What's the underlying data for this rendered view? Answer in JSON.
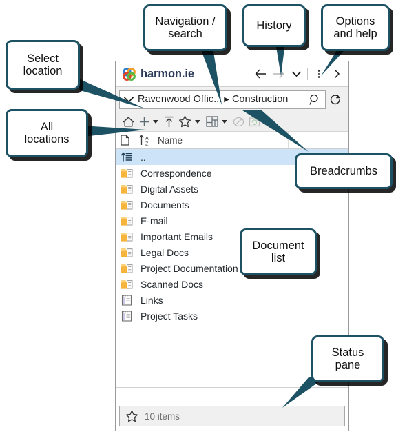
{
  "app": {
    "name": "harmon.ie",
    "brand_color": "#2b3b57",
    "logo_icon": "harmonie-rings-logo",
    "logo_colors": [
      "#2f7fd1",
      "#58b947",
      "#f0a02a",
      "#e0452c"
    ]
  },
  "titlebar": {
    "buttons": [
      {
        "name": "back-button",
        "icon": "arrow-left-icon",
        "label": "←",
        "state": "enabled"
      },
      {
        "name": "forward-button",
        "icon": "arrow-right-icon",
        "label": "→",
        "state": "disabled"
      },
      {
        "name": "history-button",
        "icon": "chevron-down-icon",
        "label": "⌄",
        "state": "enabled"
      },
      {
        "name": "options-button",
        "icon": "kebab-menu-icon",
        "label": "⋮",
        "state": "enabled"
      },
      {
        "name": "help-button",
        "icon": "chevron-right-icon",
        "label": "›",
        "state": "enabled"
      }
    ]
  },
  "location_bar": {
    "select_location_icon": "chevron-down-icon",
    "breadcrumbs": [
      "Ravenwood Offic...",
      "Construction"
    ],
    "separator": "▶",
    "search_icon": "magnifier-icon",
    "refresh_icon": "refresh-icon"
  },
  "command_bar": {
    "items": [
      {
        "name": "all-locations-button",
        "icon": "home-icon",
        "state": "enabled",
        "caret": false
      },
      {
        "name": "new-item-button",
        "icon": "plus-icon",
        "state": "enabled",
        "caret": true
      },
      {
        "name": "upload-button",
        "icon": "upload-arrow-icon",
        "state": "enabled",
        "caret": false
      },
      {
        "name": "favorites-button",
        "icon": "star-icon",
        "state": "enabled",
        "caret": true
      },
      {
        "name": "view-layout-button",
        "icon": "layout-grid-icon",
        "state": "enabled",
        "caret": true
      },
      {
        "name": "no-preview-button",
        "icon": "slashed-circle-icon",
        "state": "disabled",
        "caret": false
      },
      {
        "name": "sync-button",
        "icon": "sync-folder-icon",
        "state": "disabled",
        "caret": false
      }
    ]
  },
  "list_header": {
    "doc_icon": "document-icon",
    "sort_icon": "sort-az-icon",
    "name_column": "Name"
  },
  "document_list": {
    "rows": [
      {
        "icon": "up-level-icon",
        "label": "..",
        "selected": true
      },
      {
        "icon": "folder-icon",
        "label": "Correspondence",
        "selected": false
      },
      {
        "icon": "folder-icon",
        "label": "Digital Assets",
        "selected": false
      },
      {
        "icon": "folder-icon",
        "label": "Documents",
        "selected": false
      },
      {
        "icon": "folder-icon",
        "label": "E-mail",
        "selected": false
      },
      {
        "icon": "folder-icon",
        "label": "Important Emails",
        "selected": false
      },
      {
        "icon": "folder-icon",
        "label": "Legal Docs",
        "selected": false
      },
      {
        "icon": "folder-icon",
        "label": "Project Documentation",
        "selected": false
      },
      {
        "icon": "folder-icon",
        "label": "Scanned Docs",
        "selected": false
      },
      {
        "icon": "list-icon",
        "label": "Links",
        "selected": false
      },
      {
        "icon": "list-icon",
        "label": "Project Tasks",
        "selected": false
      }
    ]
  },
  "status_pane": {
    "icon": "star-icon",
    "text": "10 items"
  },
  "annotations": {
    "select_location": "Select\nlocation",
    "all_locations": "All\nlocations",
    "navigation_search": "Navigation /\nsearch",
    "history": "History",
    "options_and_help": "Options\nand help",
    "breadcrumbs": "Breadcrumbs",
    "document_list": "Document\nlist",
    "status_pane": "Status\npane"
  }
}
